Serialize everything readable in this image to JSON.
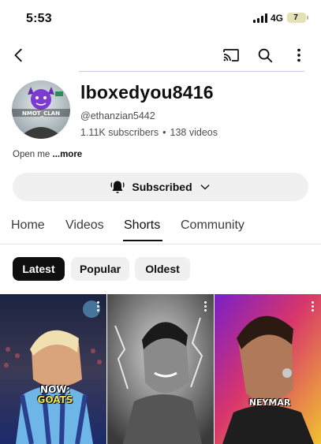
{
  "status_bar": {
    "time": "5:53",
    "network": "4G",
    "battery": "7"
  },
  "app_bar": {
    "icons": [
      "back-icon",
      "cast-icon",
      "search-icon",
      "more-vert-icon"
    ]
  },
  "channel": {
    "name": "lboxedyou8416",
    "handle": "@ethanzian5442",
    "subscribers": "1.11K subscribers",
    "separator": "•",
    "videos": "138 videos",
    "description": "Open me ",
    "more_label": "...more",
    "avatar_text": "NMOT_CLAN"
  },
  "subscribe_button": {
    "label": "Subscribed",
    "icons": [
      "bell-icon",
      "chevron-down-icon"
    ]
  },
  "tabs": [
    {
      "label": "Home",
      "active": false
    },
    {
      "label": "Videos",
      "active": false
    },
    {
      "label": "Shorts",
      "active": true
    },
    {
      "label": "Community",
      "active": false
    }
  ],
  "filter_chips": [
    {
      "label": "Latest",
      "active": true
    },
    {
      "label": "Popular",
      "active": false
    },
    {
      "label": "Oldest",
      "active": false
    }
  ],
  "shorts": [
    {
      "caption_line1": "NOW:",
      "caption_line2": "GOATS"
    },
    {
      "caption": ""
    },
    {
      "caption": "NEYMAR"
    }
  ],
  "colors": {
    "accent_dark": "#0f0f0f",
    "chip_bg": "#f0f0f0",
    "caption_yellow": "#f2e14a"
  }
}
